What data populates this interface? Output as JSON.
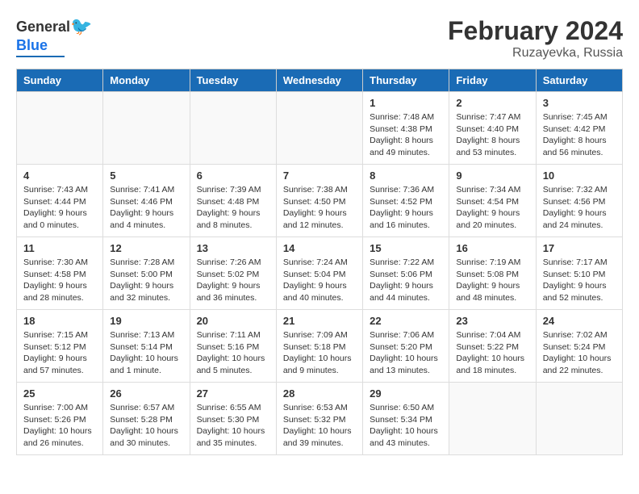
{
  "header": {
    "logo_general": "General",
    "logo_blue": "Blue",
    "title": "February 2024",
    "subtitle": "Ruzayevka, Russia"
  },
  "days_of_week": [
    "Sunday",
    "Monday",
    "Tuesday",
    "Wednesday",
    "Thursday",
    "Friday",
    "Saturday"
  ],
  "weeks": [
    [
      {
        "day": "",
        "info": ""
      },
      {
        "day": "",
        "info": ""
      },
      {
        "day": "",
        "info": ""
      },
      {
        "day": "",
        "info": ""
      },
      {
        "day": "1",
        "info": "Sunrise: 7:48 AM\nSunset: 4:38 PM\nDaylight: 8 hours\nand 49 minutes."
      },
      {
        "day": "2",
        "info": "Sunrise: 7:47 AM\nSunset: 4:40 PM\nDaylight: 8 hours\nand 53 minutes."
      },
      {
        "day": "3",
        "info": "Sunrise: 7:45 AM\nSunset: 4:42 PM\nDaylight: 8 hours\nand 56 minutes."
      }
    ],
    [
      {
        "day": "4",
        "info": "Sunrise: 7:43 AM\nSunset: 4:44 PM\nDaylight: 9 hours\nand 0 minutes."
      },
      {
        "day": "5",
        "info": "Sunrise: 7:41 AM\nSunset: 4:46 PM\nDaylight: 9 hours\nand 4 minutes."
      },
      {
        "day": "6",
        "info": "Sunrise: 7:39 AM\nSunset: 4:48 PM\nDaylight: 9 hours\nand 8 minutes."
      },
      {
        "day": "7",
        "info": "Sunrise: 7:38 AM\nSunset: 4:50 PM\nDaylight: 9 hours\nand 12 minutes."
      },
      {
        "day": "8",
        "info": "Sunrise: 7:36 AM\nSunset: 4:52 PM\nDaylight: 9 hours\nand 16 minutes."
      },
      {
        "day": "9",
        "info": "Sunrise: 7:34 AM\nSunset: 4:54 PM\nDaylight: 9 hours\nand 20 minutes."
      },
      {
        "day": "10",
        "info": "Sunrise: 7:32 AM\nSunset: 4:56 PM\nDaylight: 9 hours\nand 24 minutes."
      }
    ],
    [
      {
        "day": "11",
        "info": "Sunrise: 7:30 AM\nSunset: 4:58 PM\nDaylight: 9 hours\nand 28 minutes."
      },
      {
        "day": "12",
        "info": "Sunrise: 7:28 AM\nSunset: 5:00 PM\nDaylight: 9 hours\nand 32 minutes."
      },
      {
        "day": "13",
        "info": "Sunrise: 7:26 AM\nSunset: 5:02 PM\nDaylight: 9 hours\nand 36 minutes."
      },
      {
        "day": "14",
        "info": "Sunrise: 7:24 AM\nSunset: 5:04 PM\nDaylight: 9 hours\nand 40 minutes."
      },
      {
        "day": "15",
        "info": "Sunrise: 7:22 AM\nSunset: 5:06 PM\nDaylight: 9 hours\nand 44 minutes."
      },
      {
        "day": "16",
        "info": "Sunrise: 7:19 AM\nSunset: 5:08 PM\nDaylight: 9 hours\nand 48 minutes."
      },
      {
        "day": "17",
        "info": "Sunrise: 7:17 AM\nSunset: 5:10 PM\nDaylight: 9 hours\nand 52 minutes."
      }
    ],
    [
      {
        "day": "18",
        "info": "Sunrise: 7:15 AM\nSunset: 5:12 PM\nDaylight: 9 hours\nand 57 minutes."
      },
      {
        "day": "19",
        "info": "Sunrise: 7:13 AM\nSunset: 5:14 PM\nDaylight: 10 hours\nand 1 minute."
      },
      {
        "day": "20",
        "info": "Sunrise: 7:11 AM\nSunset: 5:16 PM\nDaylight: 10 hours\nand 5 minutes."
      },
      {
        "day": "21",
        "info": "Sunrise: 7:09 AM\nSunset: 5:18 PM\nDaylight: 10 hours\nand 9 minutes."
      },
      {
        "day": "22",
        "info": "Sunrise: 7:06 AM\nSunset: 5:20 PM\nDaylight: 10 hours\nand 13 minutes."
      },
      {
        "day": "23",
        "info": "Sunrise: 7:04 AM\nSunset: 5:22 PM\nDaylight: 10 hours\nand 18 minutes."
      },
      {
        "day": "24",
        "info": "Sunrise: 7:02 AM\nSunset: 5:24 PM\nDaylight: 10 hours\nand 22 minutes."
      }
    ],
    [
      {
        "day": "25",
        "info": "Sunrise: 7:00 AM\nSunset: 5:26 PM\nDaylight: 10 hours\nand 26 minutes."
      },
      {
        "day": "26",
        "info": "Sunrise: 6:57 AM\nSunset: 5:28 PM\nDaylight: 10 hours\nand 30 minutes."
      },
      {
        "day": "27",
        "info": "Sunrise: 6:55 AM\nSunset: 5:30 PM\nDaylight: 10 hours\nand 35 minutes."
      },
      {
        "day": "28",
        "info": "Sunrise: 6:53 AM\nSunset: 5:32 PM\nDaylight: 10 hours\nand 39 minutes."
      },
      {
        "day": "29",
        "info": "Sunrise: 6:50 AM\nSunset: 5:34 PM\nDaylight: 10 hours\nand 43 minutes."
      },
      {
        "day": "",
        "info": ""
      },
      {
        "day": "",
        "info": ""
      }
    ]
  ]
}
